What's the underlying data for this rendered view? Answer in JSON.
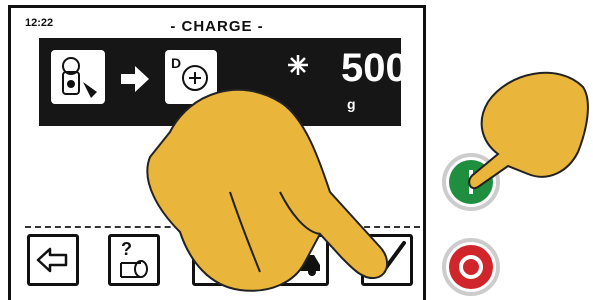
{
  "status": {
    "time": "12:22"
  },
  "screen": {
    "title": "- CHARGE -"
  },
  "charge": {
    "amount": "500",
    "unit": "g"
  },
  "softkeys": [
    {
      "name": "back-button"
    },
    {
      "name": "help-button"
    },
    {
      "name": "unknown-button"
    },
    {
      "name": "vehicle-button"
    },
    {
      "name": "confirm-button"
    }
  ],
  "hardware_buttons": {
    "start": {
      "color": "#1f8f3f"
    },
    "stop": {
      "color": "#d0262b"
    }
  }
}
